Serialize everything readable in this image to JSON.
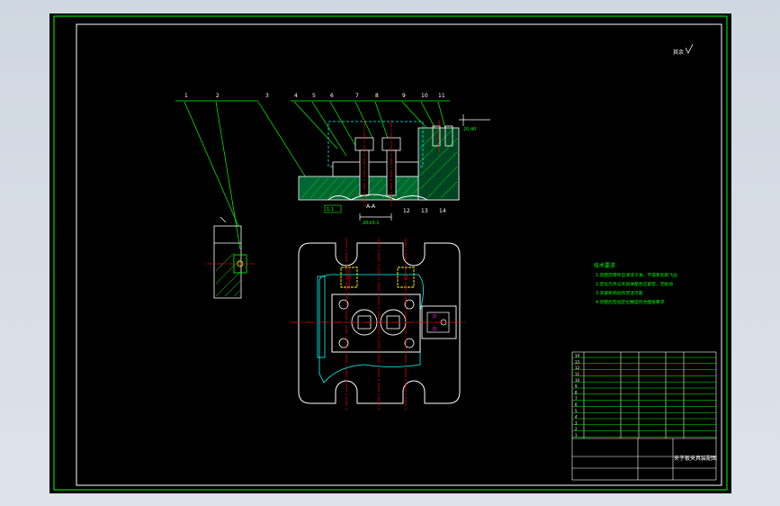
{
  "drawing": {
    "title_block_name": "夹子板夹具装配图",
    "roughness_symbol": "其余",
    "section_label": "A-A",
    "dimension_label": "20±0.1",
    "part_numbers": [
      "1",
      "2",
      "3",
      "4",
      "5",
      "6",
      "7",
      "8",
      "9",
      "10",
      "11",
      "12",
      "13",
      "14"
    ],
    "technical_requirements": {
      "heading": "技术要求",
      "lines": [
        "1.装配前零件应清洗干净，不得有毛刺飞边",
        "2.定位元件与夹具体配合应紧密，无松动",
        "3.夹紧机构动作灵活可靠",
        "4.装配后检验定位精度符合图纸要求"
      ]
    },
    "colors": {
      "sheet": "#000000",
      "frame": "#00ff00",
      "outline": "#ffffff",
      "centerline": "#ff0000",
      "hidden": "#00ffff",
      "hatch": "#00ff00",
      "leader": "#00ff00",
      "yellow": "#ffff00",
      "magenta": "#ff00ff"
    }
  }
}
